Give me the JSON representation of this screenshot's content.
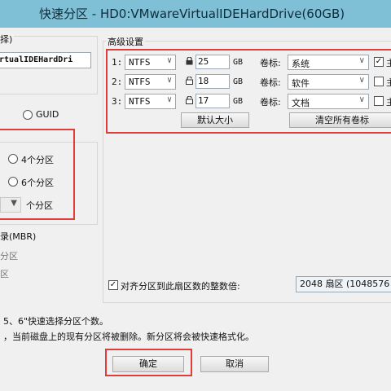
{
  "window": {
    "title": "快速分区 - HD0:VMwareVirtualIDEHardDrive(60GB)"
  },
  "left_panel": {
    "disk_group_label_partial": "择)",
    "disk_name_partial": "rtualIDEHardDri",
    "guid_label": "GUID",
    "count_options": [
      "4个分区",
      "6个分区"
    ],
    "custom_count_label": "个分区",
    "mbr_label_partial": "录(MBR)",
    "mbr_item_partial": "分区",
    "mbr_item2_partial": "区"
  },
  "advanced": {
    "group_label": "高级设置",
    "rows": [
      {
        "index": "1:",
        "fs": "NTFS",
        "size": "25",
        "unit": "GB",
        "vol_label": "卷标:",
        "volume": "系统",
        "checked": true,
        "tail": "主"
      },
      {
        "index": "2:",
        "fs": "NTFS",
        "size": "18",
        "unit": "GB",
        "vol_label": "卷标:",
        "volume": "软件",
        "checked": false,
        "tail": "主"
      },
      {
        "index": "3:",
        "fs": "NTFS",
        "size": "17",
        "unit": "GB",
        "vol_label": "卷标:",
        "volume": "文档",
        "checked": false,
        "tail": "主"
      }
    ],
    "default_size_button": "默认大小",
    "clear_labels_button": "清空所有卷标",
    "align_label": "对齐分区到此扇区数的整数倍:",
    "align_value": "2048 扇区 (1048576"
  },
  "notes": {
    "line1": "5、6\"快速选择分区个数。",
    "line2": "，当前磁盘上的现有分区将被删除。新分区将会被快速格式化。"
  },
  "buttons": {
    "ok": "确定",
    "cancel": "取消"
  },
  "colors": {
    "highlight_red": "#e23b3b",
    "title_bg": "#7fc0d6"
  }
}
